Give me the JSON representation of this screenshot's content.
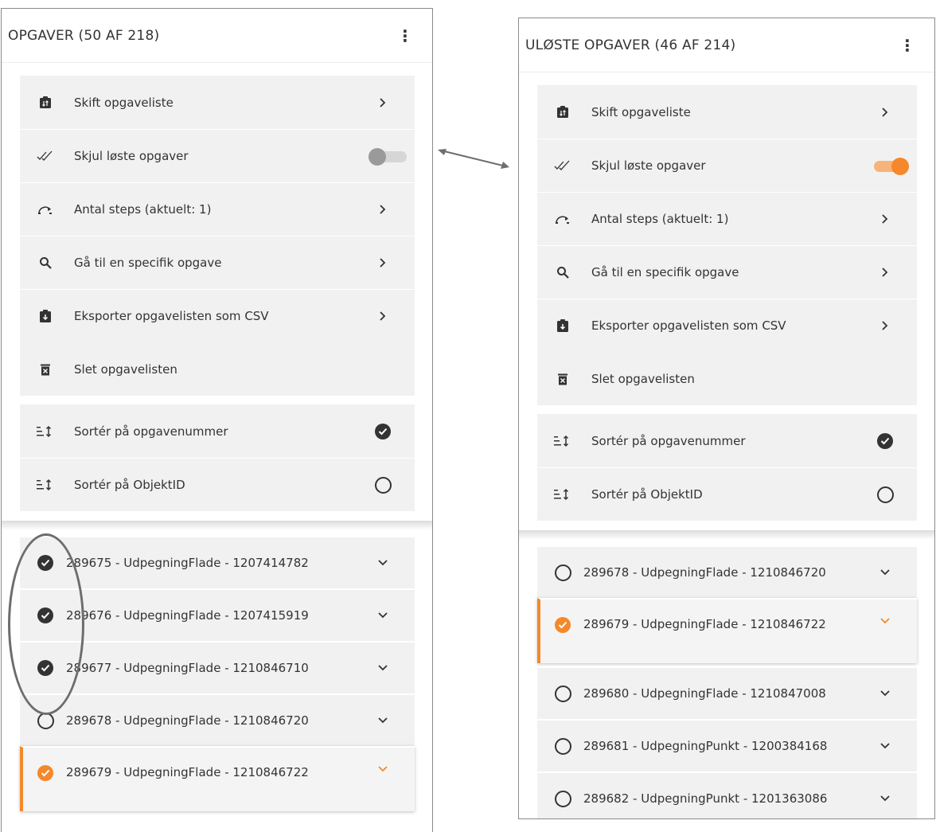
{
  "left_panel": {
    "title": "OPGAVER (50 AF 218)",
    "menu_items": [
      {
        "label": "Skift opgaveliste",
        "icon": "swap-list-icon",
        "end": "chevron"
      },
      {
        "label": "Skjul løste opgaver",
        "icon": "double-check-icon",
        "end": "toggle",
        "toggle_on": false
      },
      {
        "label": "Antal steps (aktuelt: 1)",
        "icon": "step-skip-icon",
        "end": "chevron"
      },
      {
        "label": "Gå til en specifik opgave",
        "icon": "search-icon",
        "end": "chevron"
      },
      {
        "label": "Eksporter opgavelisten som CSV",
        "icon": "clipboard-export-icon",
        "end": "chevron"
      },
      {
        "label": "Slet opgavelisten",
        "icon": "trash-icon",
        "end": "none"
      }
    ],
    "sort_items": [
      {
        "label": "Sortér på opgavenummer",
        "icon": "sort-icon",
        "selected": true
      },
      {
        "label": "Sortér på ObjektID",
        "icon": "sort-icon",
        "selected": false
      }
    ],
    "tasks": [
      {
        "label": "289675 - UdpegningFlade - 1207414782",
        "status": "solved"
      },
      {
        "label": "289676 - UdpegningFlade - 1207415919",
        "status": "solved"
      },
      {
        "label": "289677 - UdpegningFlade - 1210846710",
        "status": "solved"
      },
      {
        "label": "289678 - UdpegningFlade - 1210846720",
        "status": "unsolved"
      },
      {
        "label": "289679 - UdpegningFlade - 1210846722",
        "status": "active"
      }
    ]
  },
  "right_panel": {
    "title": "ULØSTE OPGAVER (46 AF 214)",
    "menu_items": [
      {
        "label": "Skift opgaveliste",
        "icon": "swap-list-icon",
        "end": "chevron"
      },
      {
        "label": "Skjul løste opgaver",
        "icon": "double-check-icon",
        "end": "toggle",
        "toggle_on": true
      },
      {
        "label": "Antal steps (aktuelt: 1)",
        "icon": "step-skip-icon",
        "end": "chevron"
      },
      {
        "label": "Gå til en specifik opgave",
        "icon": "search-icon",
        "end": "chevron"
      },
      {
        "label": "Eksporter opgavelisten som CSV",
        "icon": "clipboard-export-icon",
        "end": "chevron"
      },
      {
        "label": "Slet opgavelisten",
        "icon": "trash-icon",
        "end": "none"
      }
    ],
    "sort_items": [
      {
        "label": "Sortér på opgavenummer",
        "icon": "sort-icon",
        "selected": true
      },
      {
        "label": "Sortér på ObjektID",
        "icon": "sort-icon",
        "selected": false
      }
    ],
    "tasks": [
      {
        "label": "289678 - UdpegningFlade - 1210846720",
        "status": "unsolved"
      },
      {
        "label": "289679 - UdpegningFlade - 1210846722",
        "status": "active"
      },
      {
        "label": "289680 - UdpegningFlade - 1210847008",
        "status": "unsolved"
      },
      {
        "label": "289681 - UdpegningPunkt - 1200384168",
        "status": "unsolved"
      },
      {
        "label": "289682 - UdpegningPunkt - 1201363086",
        "status": "unsolved"
      }
    ]
  },
  "colors": {
    "accent": "#f5882a",
    "accent_light": "#f7b47a",
    "row_bg": "#f1f1f1",
    "text": "#333333",
    "annotation": "#6d6d6d"
  }
}
